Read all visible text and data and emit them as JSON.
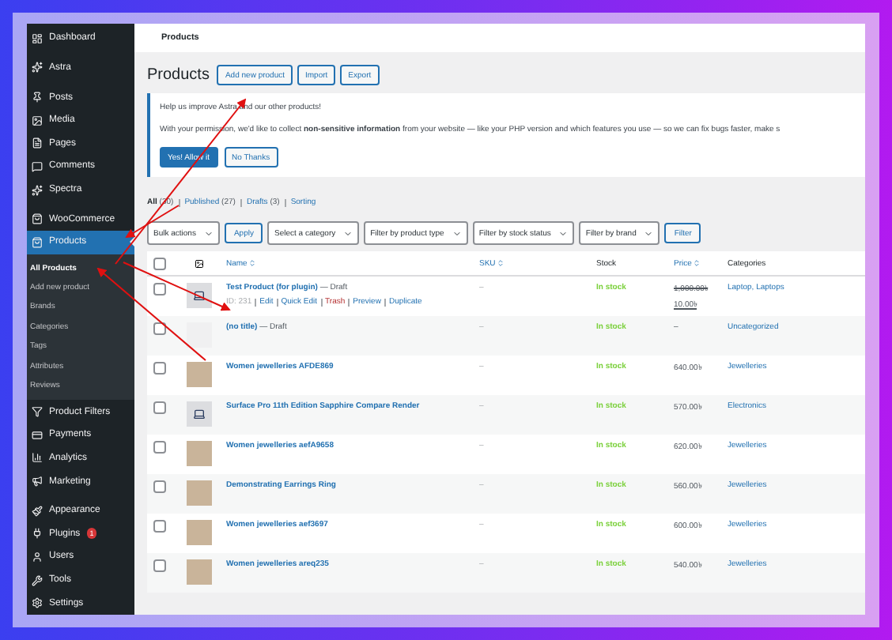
{
  "sidebar": {
    "items": [
      {
        "label": "Dashboard",
        "selected": false
      },
      {
        "label": "Astra",
        "selected": false
      },
      {
        "label": "Posts",
        "selected": false
      },
      {
        "label": "Media",
        "selected": false
      },
      {
        "label": "Pages",
        "selected": false
      },
      {
        "label": "Comments",
        "selected": false
      },
      {
        "label": "Spectra",
        "selected": false
      },
      {
        "label": "WooCommerce",
        "selected": false
      },
      {
        "label": "Products",
        "selected": true,
        "children": [
          {
            "label": "All Products",
            "selected": true
          },
          {
            "label": "Add new product",
            "selected": false
          },
          {
            "label": "Brands",
            "selected": false
          },
          {
            "label": "Categories",
            "selected": false
          },
          {
            "label": "Tags",
            "selected": false
          },
          {
            "label": "Attributes",
            "selected": false
          },
          {
            "label": "Reviews",
            "selected": false
          }
        ]
      },
      {
        "label": "Product Filters",
        "selected": false
      },
      {
        "label": "Payments",
        "selected": false
      },
      {
        "label": "Analytics",
        "selected": false
      },
      {
        "label": "Marketing",
        "selected": false
      },
      {
        "label": "Appearance",
        "selected": false
      },
      {
        "label": "Plugins",
        "selected": false,
        "badge": "1"
      },
      {
        "label": "Users",
        "selected": false
      },
      {
        "label": "Tools",
        "selected": false
      },
      {
        "label": "Settings",
        "selected": false
      }
    ]
  },
  "header": {
    "title": "Products"
  },
  "page": {
    "title": "Products",
    "buttons": [
      "Add new product",
      "Import",
      "Export"
    ]
  },
  "notice": {
    "heading": "Help us improve Astra and our other products!",
    "text": "With your permission, we'd like to collect **non-sensitive information** from your website — like your PHP version and which features you use — so we can fix bugs faster, make s",
    "buttons": [
      {
        "label": "Yes! Allow it",
        "kind": "primary"
      },
      {
        "label": "No Thanks",
        "kind": "secondary"
      }
    ]
  },
  "views": [
    {
      "label": "All",
      "count": "(30)",
      "selected": true
    },
    {
      "label": "Published",
      "count": "(27)",
      "selected": false
    },
    {
      "label": "Drafts",
      "count": "(3)",
      "selected": false
    },
    {
      "label": "Sorting",
      "selected": false
    }
  ],
  "filters": [
    {
      "label": "Bulk actions",
      "kind": "select"
    },
    {
      "label": "Apply",
      "kind": "button"
    },
    {
      "label": "Select a category",
      "kind": "select"
    },
    {
      "label": "Filter by product type",
      "kind": "select"
    },
    {
      "label": "Filter by stock status",
      "kind": "select"
    },
    {
      "label": "Filter by brand",
      "kind": "select"
    },
    {
      "label": "Filter",
      "kind": "button"
    }
  ],
  "table": {
    "select_all": {
      "checked": false
    },
    "columns": [
      {
        "label": "Name",
        "sortable": true
      },
      {
        "label": "SKU",
        "sortable": true
      },
      {
        "label": "Stock",
        "sortable": false
      },
      {
        "label": "Price",
        "sortable": true
      },
      {
        "label": "Categories",
        "sortable": false
      }
    ],
    "rows": [
      {
        "checked": false,
        "name": "Test Product (for plugin)",
        "status": "— Draft",
        "meta": "ID: 231",
        "actions": [
          {
            "label": "Edit",
            "kind": "link"
          },
          {
            "label": "Quick Edit",
            "kind": "link"
          },
          {
            "label": "Trash",
            "kind": "danger"
          },
          {
            "label": "Preview",
            "kind": "link"
          },
          {
            "label": "Duplicate",
            "kind": "link"
          }
        ],
        "sku": "–",
        "stock": "In stock",
        "old_price": "1,000.00৳",
        "price": "10.00৳",
        "categories": "Laptop, Laptops"
      },
      {
        "checked": false,
        "name": "(no title)",
        "status": "— Draft",
        "sku": "–",
        "stock": "In stock",
        "price": "–",
        "categories": "Uncategorized"
      },
      {
        "checked": false,
        "name": "Women jewelleries AFDE869",
        "sku": "–",
        "stock": "In stock",
        "price": "640.00৳",
        "categories": "Jewelleries"
      },
      {
        "checked": false,
        "name": "Surface Pro 11th Edition Sapphire Compare Render",
        "sku": "–",
        "stock": "In stock",
        "price": "570.00৳",
        "categories": "Electronics"
      },
      {
        "checked": false,
        "name": "Women jewelleries aefA9658",
        "sku": "–",
        "stock": "In stock",
        "price": "620.00৳",
        "categories": "Jewelleries"
      },
      {
        "checked": false,
        "name": "Demonstrating Earrings Ring",
        "sku": "–",
        "stock": "In stock",
        "price": "560.00৳",
        "categories": "Jewelleries"
      },
      {
        "checked": false,
        "name": "Women jewelleries aef3697",
        "sku": "–",
        "stock": "In stock",
        "price": "600.00৳",
        "categories": "Jewelleries"
      },
      {
        "checked": false,
        "name": "Women jewelleries areq235",
        "sku": "–",
        "stock": "In stock",
        "price": "540.00৳",
        "categories": "Jewelleries"
      }
    ]
  }
}
